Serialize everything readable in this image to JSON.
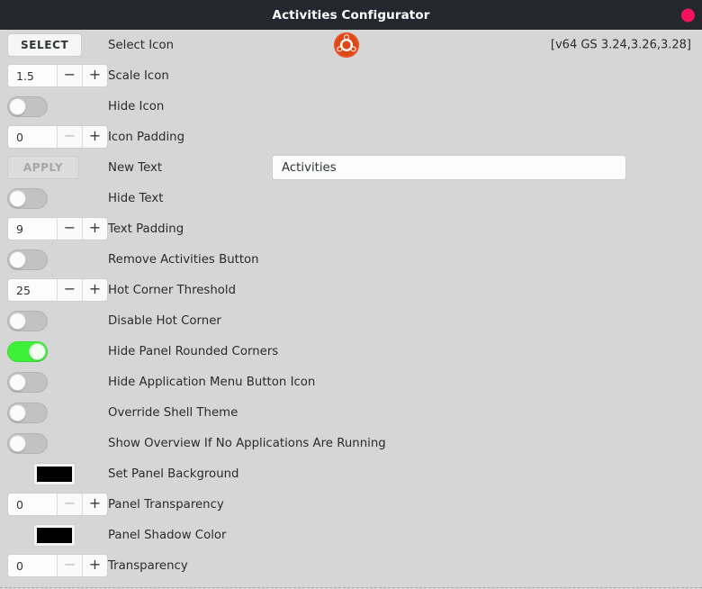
{
  "window": {
    "title": "Activities Configurator",
    "close_icon": "close-circle-icon"
  },
  "header": {
    "version_text": "[v64 GS 3.24,3.26,3.28]",
    "icon_preview_name": "ubuntu-logo-icon"
  },
  "colors": {
    "titlebar_bg": "#25272f",
    "window_bg": "#d6d6d6",
    "close_button": "#f5125f",
    "toggle_on": "#3ef038",
    "toggle_off": "#c2c2c2",
    "swatch_black": "#000000",
    "text": "#2b2b2b"
  },
  "rows": [
    {
      "id": "select-icon",
      "control": "button",
      "button_label": "SELECT",
      "disabled": false,
      "label": "Select Icon"
    },
    {
      "id": "scale-icon",
      "control": "spin",
      "value": "1.5",
      "minus": "−",
      "plus": "+",
      "minus_dim": false,
      "label": "Scale Icon"
    },
    {
      "id": "hide-icon",
      "control": "switch",
      "on": false,
      "label": "Hide Icon"
    },
    {
      "id": "icon-padding",
      "control": "spin",
      "value": "0",
      "minus": "−",
      "plus": "+",
      "minus_dim": true,
      "label": "Icon Padding"
    },
    {
      "id": "new-text",
      "control": "button",
      "button_label": "APPLY",
      "disabled": true,
      "label": "New Text",
      "entry_value": "Activities",
      "entry_placeholder": ""
    },
    {
      "id": "hide-text",
      "control": "switch",
      "on": false,
      "label": "Hide Text"
    },
    {
      "id": "text-padding",
      "control": "spin",
      "value": "9",
      "minus": "−",
      "plus": "+",
      "minus_dim": false,
      "label": "Text Padding"
    },
    {
      "id": "remove-activities-button",
      "control": "switch",
      "on": false,
      "label": "Remove Activities Button"
    },
    {
      "id": "hot-corner-threshold",
      "control": "spin",
      "value": "25",
      "minus": "−",
      "plus": "+",
      "minus_dim": false,
      "label": "Hot Corner Threshold"
    },
    {
      "id": "disable-hot-corner",
      "control": "switch",
      "on": false,
      "label": "Disable Hot Corner"
    },
    {
      "id": "hide-panel-rounded-corners",
      "control": "switch",
      "on": true,
      "label": "Hide Panel Rounded Corners"
    },
    {
      "id": "hide-application-menu-button-icon",
      "control": "switch",
      "on": false,
      "label": "Hide Application Menu Button Icon"
    },
    {
      "id": "override-shell-theme",
      "control": "switch",
      "on": false,
      "label": "Override Shell Theme"
    },
    {
      "id": "show-overview-if-no-applications-are-running",
      "control": "switch",
      "on": false,
      "label": "Show Overview If No Applications Are Running"
    },
    {
      "id": "set-panel-background",
      "control": "color",
      "color": "#000000",
      "label": "Set Panel Background"
    },
    {
      "id": "panel-transparency",
      "control": "spin",
      "value": "0",
      "minus": "−",
      "plus": "+",
      "minus_dim": true,
      "label": "Panel Transparency"
    },
    {
      "id": "panel-shadow-color",
      "control": "color",
      "color": "#000000",
      "label": "Panel Shadow Color"
    },
    {
      "id": "transparency",
      "control": "spin",
      "value": "0",
      "minus": "−",
      "plus": "+",
      "minus_dim": true,
      "label": "Transparency"
    }
  ]
}
